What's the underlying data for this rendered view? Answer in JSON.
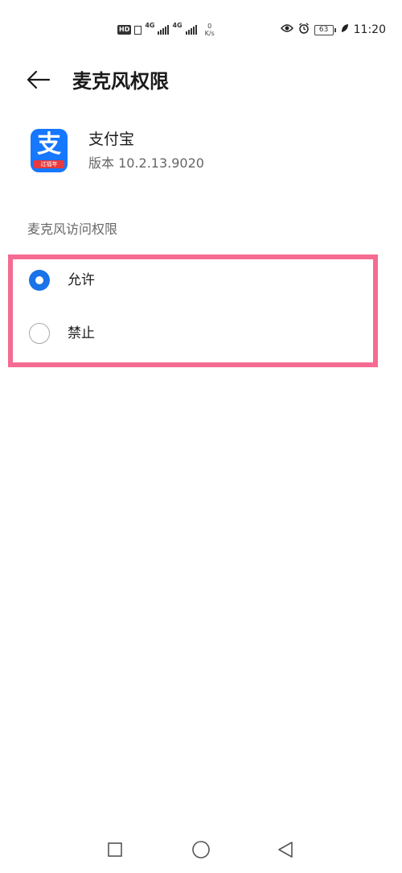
{
  "status_bar": {
    "network_hd": "HD",
    "network_1": "4G",
    "network_2": "4G",
    "speed_value": "0",
    "speed_unit": "K/s",
    "battery": "63",
    "time": "11:20"
  },
  "header": {
    "title": "麦克风权限"
  },
  "app": {
    "icon_glyph": "支",
    "icon_ribbon": "过福年",
    "name": "支付宝",
    "version": "版本 10.2.13.9020"
  },
  "section": {
    "label": "麦克风访问权限"
  },
  "options": [
    {
      "label": "允许",
      "selected": true
    },
    {
      "label": "禁止",
      "selected": false
    }
  ],
  "colors": {
    "accent": "#1a73e8",
    "highlight_border": "#f56b92",
    "app_icon_bg": "#1677ff"
  }
}
